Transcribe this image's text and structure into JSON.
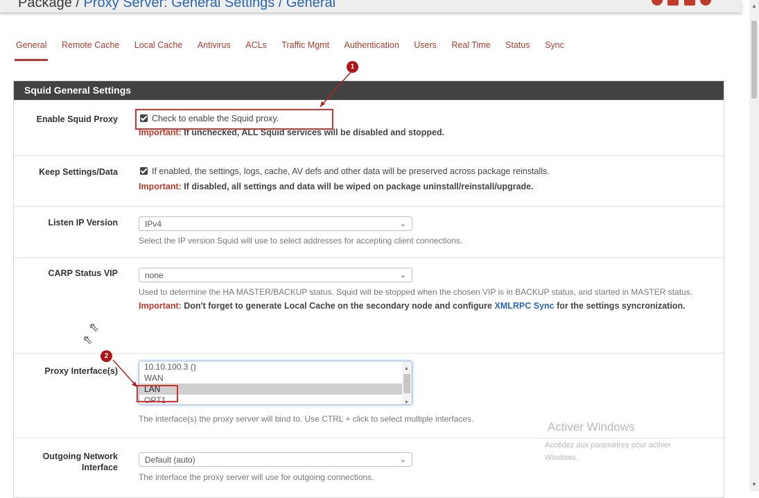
{
  "header": {
    "breadcrumb_prefix": "Package / ",
    "breadcrumb_link": "Proxy Server: General Settings / General"
  },
  "tabs": [
    "General",
    "Remote Cache",
    "Local Cache",
    "Antivirus",
    "ACLs",
    "Traffic Mgmt",
    "Authentication",
    "Users",
    "Real Time",
    "Status",
    "Sync"
  ],
  "panel": {
    "title": "Squid General Settings"
  },
  "rows": {
    "enable": {
      "label": "Enable Squid Proxy",
      "checkbox_text": "Check to enable the Squid proxy.",
      "checked": true,
      "important_key": "Important:",
      "important_text": "If unchecked, ALL Squid services will be disabled and stopped."
    },
    "keep": {
      "label": "Keep Settings/Data",
      "checkbox_text": "If enabled, the settings, logs, cache, AV defs and other data will be preserved across package reinstalls.",
      "checked": true,
      "important_key": "Important:",
      "important_text": "If disabled, all settings and data will be wiped on package uninstall/reinstall/upgrade."
    },
    "listen_ip": {
      "label": "Listen IP Version",
      "value": "IPv4",
      "help": "Select the IP version Squid will use to select addresses for accepting client connections."
    },
    "carp": {
      "label": "CARP Status VIP",
      "value": "none",
      "help": "Used to determine the HA MASTER/BACKUP status. Squid will be stopped when the chosen VIP is in BACKUP status, and started in MASTER status.",
      "important_key": "Important:",
      "important_text_1": "Don't forget to generate Local Cache on the secondary node and configure",
      "important_link": "XMLRPC Sync",
      "important_text_2": "for the settings syncronization."
    },
    "proxy_iface": {
      "label": "Proxy Interface(s)",
      "options": [
        "10.10.100.3 ()",
        "WAN",
        "LAN",
        "OPT1"
      ],
      "selected": "LAN",
      "help": "The interface(s) the proxy server will bind to. Use CTRL + click to select multiple interfaces."
    },
    "outgoing": {
      "label_1": "Outgoing Network",
      "label_2": "Interface",
      "value": "Default (auto)",
      "help": "The interface the proxy server will use for outgoing connections."
    }
  },
  "annotations": {
    "badge_1": "1",
    "badge_2": "2"
  },
  "watermark": {
    "title": "Activer Windows",
    "line_1": "Accédez aux paramètres pour activer",
    "line_2": "Windows."
  },
  "colors": {
    "accent": "#b03a2e",
    "panel_heading": "#424242",
    "annotation_red": "#d9302c",
    "link": "#2c66b2"
  }
}
